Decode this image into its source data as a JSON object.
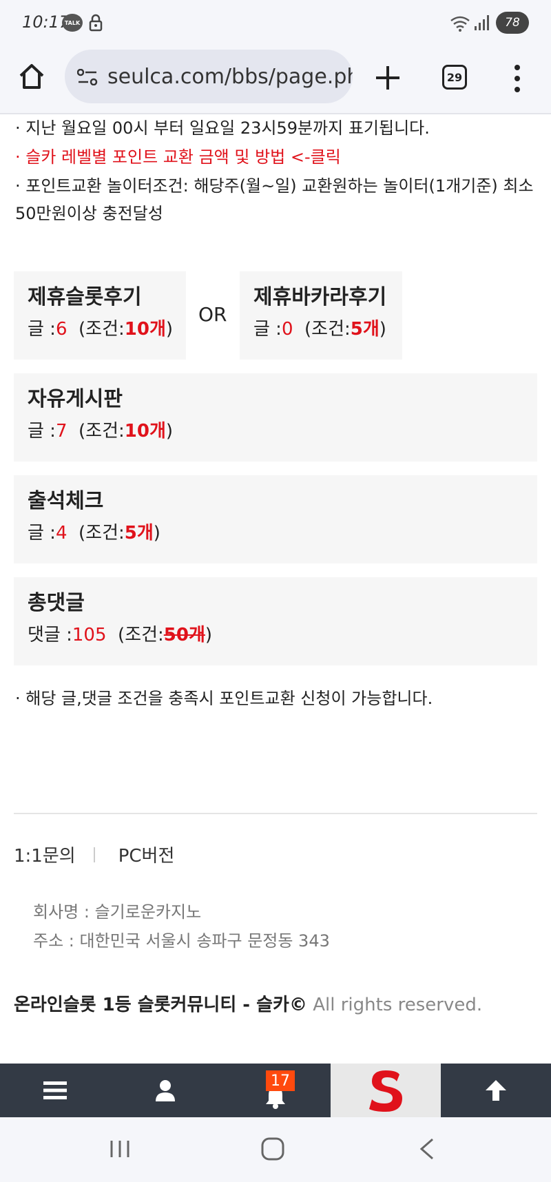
{
  "status_bar": {
    "time": "10:17",
    "talk_badge": "TALK",
    "battery": "78"
  },
  "browser": {
    "url": "seulca.com/bbs/page.ph",
    "tab_count": "29"
  },
  "notices": {
    "line1": "· 지난 월요일 00시 부터 일요일 23시59분까지 표기됩니다.",
    "line2": "· 슬카 레벨별 포인트 교환 금액 및 방법 <-클릭",
    "line3": "· 포인트교환 놀이터조건: 해당주(월~일) 교환원하는 놀이터(1개기준) 최소50만원이상 충전달성",
    "line4": "· 해당 글,댓글 조건을 충족시 포인트교환 신청이 가능합니다."
  },
  "cards": {
    "or_label": "OR",
    "slot": {
      "title": "제휴슬롯후기",
      "count_label": "글 :",
      "count": "6",
      "cond_open": "(조건:",
      "cond": "10개",
      "cond_close": ")"
    },
    "baccarat": {
      "title": "제휴바카라후기",
      "count_label": "글 :",
      "count": "0",
      "cond_open": "(조건:",
      "cond": "5개",
      "cond_close": ")"
    },
    "free": {
      "title": "자유게시판",
      "count_label": "글 :",
      "count": "7",
      "cond_open": "(조건:",
      "cond": "10개",
      "cond_close": ")"
    },
    "attend": {
      "title": "출석체크",
      "count_label": "글 :",
      "count": "4",
      "cond_open": "(조건:",
      "cond": "5개",
      "cond_close": ")"
    },
    "comment": {
      "title": "총댓글",
      "count_label": "댓글 :",
      "count": "105",
      "cond_open": "(조건:",
      "cond": "50개",
      "cond_close": ")"
    }
  },
  "footer": {
    "inquiry": "1:1문의",
    "pc_version": "PC버전",
    "company_name": "회사명 : 슬기로운카지노",
    "address": "주소 : 대한민국 서울시 송파구 문정동 343",
    "copyright_bold": "온라인슬롯 1등 슬롯커뮤니티 - 슬카©",
    "copyright_rest": " All rights reserved."
  },
  "bottom_nav": {
    "notification_count": "17",
    "logo_letter": "S"
  },
  "colors": {
    "accent_red": "#e0121b",
    "nav_bg": "#333a45",
    "badge": "#ff4a0e"
  }
}
